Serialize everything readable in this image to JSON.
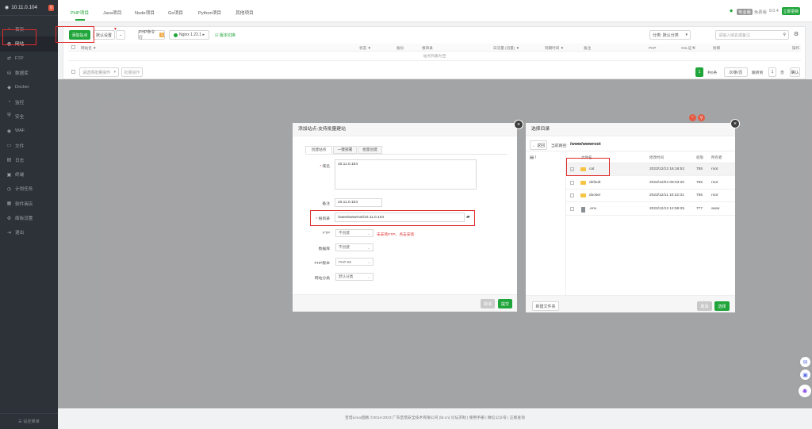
{
  "sidebar": {
    "host": "10.11.0.104",
    "badge": "0",
    "items": [
      {
        "label": "首页",
        "icon": "⌂"
      },
      {
        "label": "网站",
        "icon": "◍"
      },
      {
        "label": "FTP",
        "icon": "⇄"
      },
      {
        "label": "数据库",
        "icon": "⛁"
      },
      {
        "label": "Docker",
        "icon": "◆"
      },
      {
        "label": "监控",
        "icon": "◔"
      },
      {
        "label": "安全",
        "icon": "⛨"
      },
      {
        "label": "WAF",
        "icon": "◉"
      },
      {
        "label": "文件",
        "icon": "▭"
      },
      {
        "label": "日志",
        "icon": "▤"
      },
      {
        "label": "终端",
        "icon": "▣"
      },
      {
        "label": "计划任务",
        "icon": "◷"
      },
      {
        "label": "软件商店",
        "icon": "▦"
      },
      {
        "label": "面板设置",
        "icon": "⚙"
      },
      {
        "label": "退出",
        "icon": "⇥"
      }
    ],
    "bottom": "☰ 设定菜单"
  },
  "topbar": {
    "tabs": [
      "PHP项目",
      "Java项目",
      "Node项目",
      "Go项目",
      "Python项目",
      "其他项目"
    ],
    "version_label": "免费版",
    "version": "8.0.4",
    "update_button": "立即更新"
  },
  "toolbar": {
    "add_site": "添加站点",
    "default_settings": "默认设置",
    "php_cli": "PHP命令行",
    "php_cli_badge": "1",
    "nginx": "Nginx 1.22.1 ▸",
    "php_version_tip": "☑ 版本切换",
    "category": "分类: 默认分类",
    "search_placeholder": "请输入域名或备注"
  },
  "table": {
    "headers": [
      "网站名 ▼",
      "状态 ▼",
      "备份",
      "根目录",
      "日流量 (流量) ▼",
      "到期时间 ▼",
      "备注",
      "PHP",
      "SSL证书",
      "操作",
      "防御"
    ],
    "empty": "站点列表为空",
    "batch": "请选择批量操作",
    "batch_btn": "批量操作",
    "pager": {
      "page": "1",
      "total": "共0条",
      "per_page": "20条/页",
      "goto_label": "跳转到",
      "goto_page": "1",
      "unit": "页",
      "confirm": "确认"
    }
  },
  "add_site_dialog": {
    "title": "添加站点-支持批量建站",
    "tabs": [
      "创建站点",
      "一键部署",
      "批量创建"
    ],
    "domain_label": "域名",
    "domain_value": "10.11.0.104",
    "remark_label": "备注",
    "remark_value": "10.11.0.104",
    "root_label": "根目录",
    "root_value": "/www/wwwroot/10.11.0.104",
    "ftp_label": "FTP",
    "ftp_value": "不创建",
    "ftp_hint": "未安装FTP，点击安装",
    "db_label": "数据库",
    "db_value": "不创建",
    "php_label": "PHP版本",
    "php_value": "PHP-82",
    "category_label": "网站分类",
    "category_value": "默认分类",
    "cancel": "取消",
    "submit": "提交"
  },
  "dir_dialog": {
    "title": "选择目录",
    "back": "← 返回",
    "path_label": "当前路径:",
    "path_value": "/www/wwwroot",
    "root_node": "/",
    "headers": [
      "文件名",
      "修改时间",
      "权限",
      "所有者"
    ],
    "rows": [
      {
        "name": "cat",
        "time": "2023/12/13 16:16:52",
        "perm": "755",
        "owner": "root",
        "checked": true,
        "type": "folder"
      },
      {
        "name": "default",
        "time": "2023/12/04 09:03:20",
        "perm": "755",
        "owner": "root",
        "checked": false,
        "type": "folder"
      },
      {
        "name": "docker",
        "time": "2023/12/11 10:22:31",
        "perm": "755",
        "owner": "root",
        "checked": false,
        "type": "folder"
      },
      {
        "name": ".env",
        "time": "2023/12/13 12:59:25",
        "perm": "777",
        "owner": "www",
        "checked": false,
        "type": "file"
      }
    ],
    "new_folder": "新建文件夹",
    "cancel": "取消",
    "select": "选择"
  },
  "footer": "宝塔Linux面板 ©2014-2023 广东堡塔安全技术有限公司 (bt.cn)   论坛求助  |  使用手册  |  微信公众号  |  正版查询",
  "colors": {
    "accent": "#20a53a",
    "highlight": "#e02b2b",
    "sidebar": "#2d3138"
  }
}
